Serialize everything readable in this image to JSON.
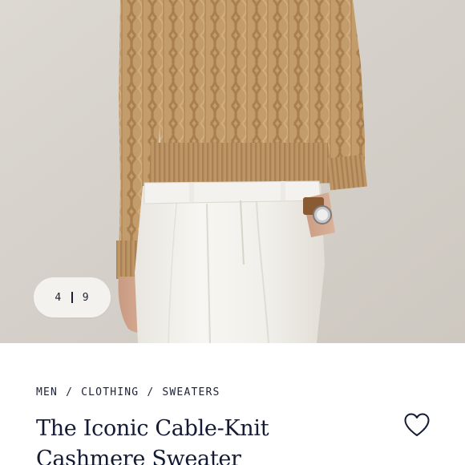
{
  "gallery": {
    "current_index": "4",
    "total_count": "9",
    "image_icon": "product-photo-sweater"
  },
  "breadcrumb": {
    "items": [
      "MEN",
      "CLOTHING",
      "SWEATERS"
    ],
    "separator": "/"
  },
  "product": {
    "title_line1": "The Iconic Cable-Knit",
    "title_line2": "Cashmere Sweater"
  },
  "wishlist": {
    "icon": "heart-outline-icon"
  },
  "colors": {
    "text_navy": "#141a33",
    "pill_bg": "#f4f2ee",
    "backdrop": "#d6d2cc",
    "sweater_camel": "#c29a6a",
    "trousers_white": "#f3f1ec"
  }
}
